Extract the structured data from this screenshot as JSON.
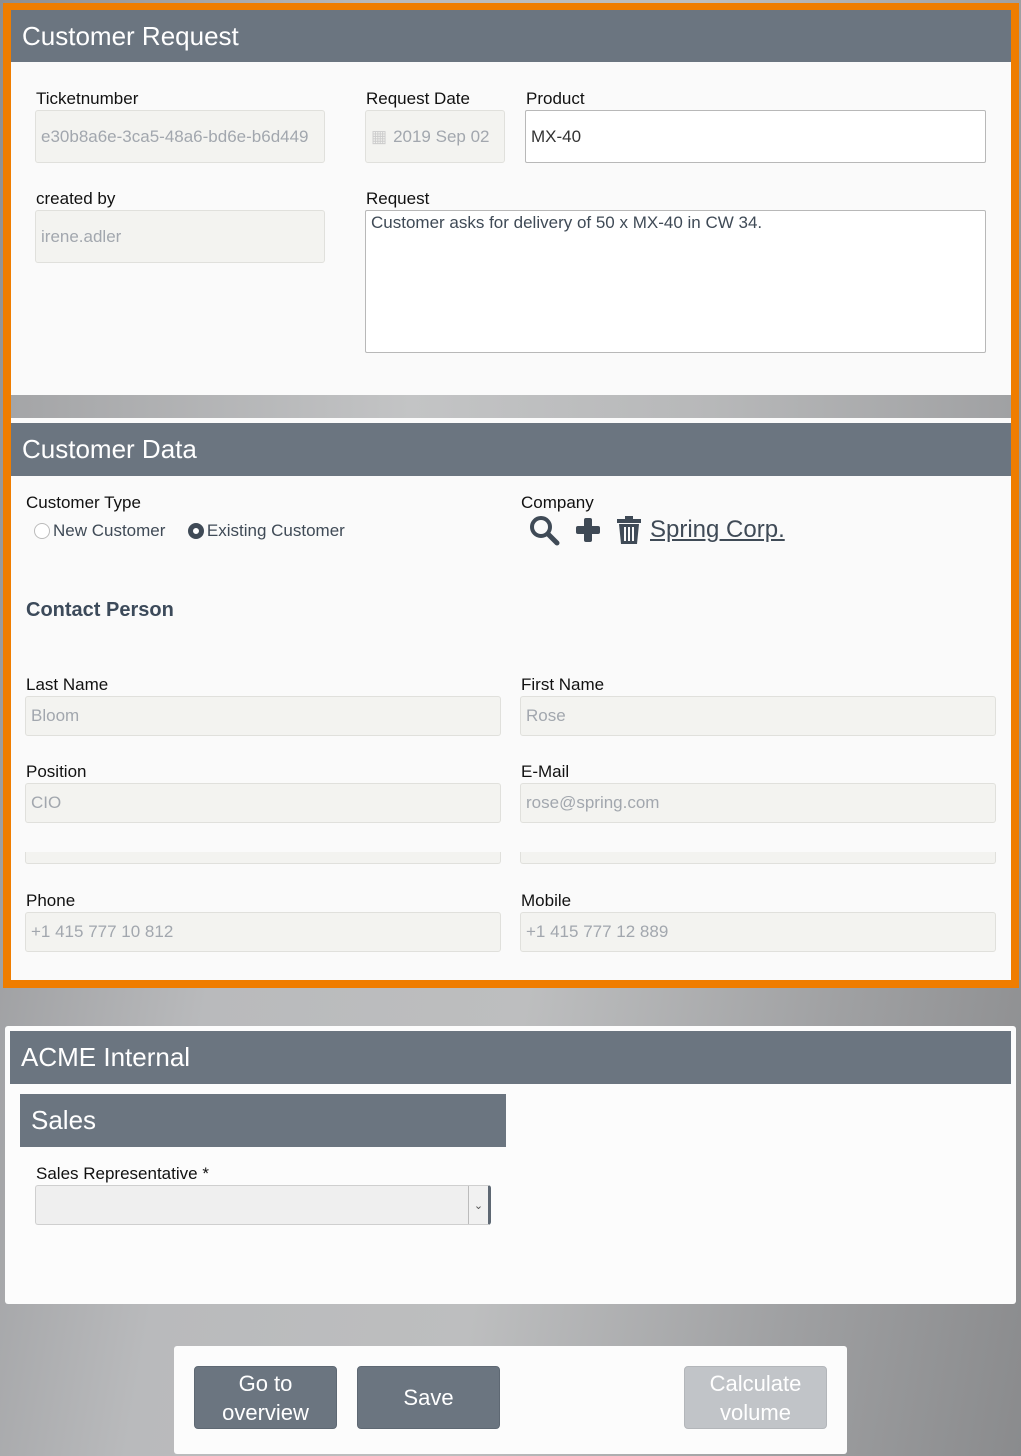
{
  "customer_request": {
    "title": "Customer Request",
    "ticket_label": "Ticketnumber",
    "ticket_value": "e30b8a6e-3ca5-48a6-bd6e-b6d449",
    "date_label": "Request Date",
    "date_value": "2019 Sep 02",
    "product_label": "Product",
    "product_value": "MX-40",
    "created_label": "created by",
    "created_value": "irene.adler",
    "request_label": "Request",
    "request_value": "Customer asks for delivery of 50 x MX-40 in CW 34."
  },
  "customer_data": {
    "title": "Customer Data",
    "type_label": "Customer Type",
    "options": [
      {
        "label": "New Customer",
        "selected": false
      },
      {
        "label": "Existing Customer",
        "selected": true
      }
    ],
    "company_label": "Company",
    "company_value": "Spring Corp.",
    "contact_title": "Contact Person",
    "last_name_label": "Last Name",
    "last_name": "Bloom",
    "first_name_label": "First Name",
    "first_name": "Rose",
    "position_label": "Position",
    "position": "CIO",
    "email_label": "E-Mail",
    "email": "rose@spring.com",
    "phone_label": "Phone",
    "phone": "+1 415 777 10 812",
    "mobile_label": "Mobile",
    "mobile": "+1 415 777 12 889"
  },
  "internal": {
    "title": "ACME Internal",
    "sales_title": "Sales",
    "rep_label": "Sales Representative *",
    "rep_value": ""
  },
  "actions": {
    "overview": "Go to overview",
    "save": "Save",
    "calculate": "Calculate volume"
  },
  "colors": {
    "accent": "#ef7d00",
    "header": "#6b7580"
  }
}
